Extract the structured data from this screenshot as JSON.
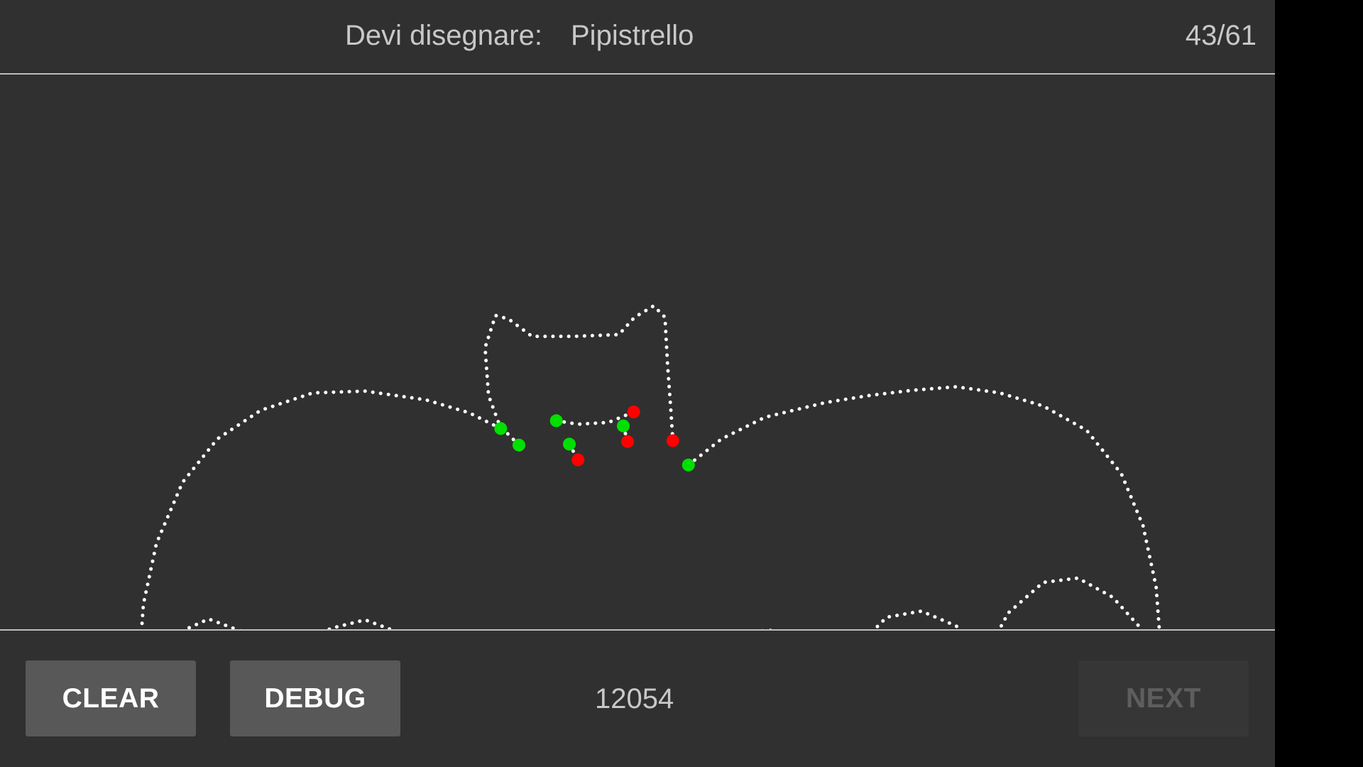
{
  "header": {
    "prompt_label": "Devi disegnare:",
    "prompt_word": "Pipistrello",
    "progress": "43/61"
  },
  "canvas": {
    "drawing_subject": "bat",
    "stroke_color": "#ffffff",
    "stroke_start_color": "#00e000",
    "stroke_end_color": "#ff0000"
  },
  "footer": {
    "clear_label": "CLEAR",
    "debug_label": "DEBUG",
    "score": "12054",
    "next_label": "NEXT"
  },
  "colors": {
    "background": "#303030",
    "button": "#585858",
    "button_disabled": "#363636",
    "text": "#c8c8c8"
  }
}
